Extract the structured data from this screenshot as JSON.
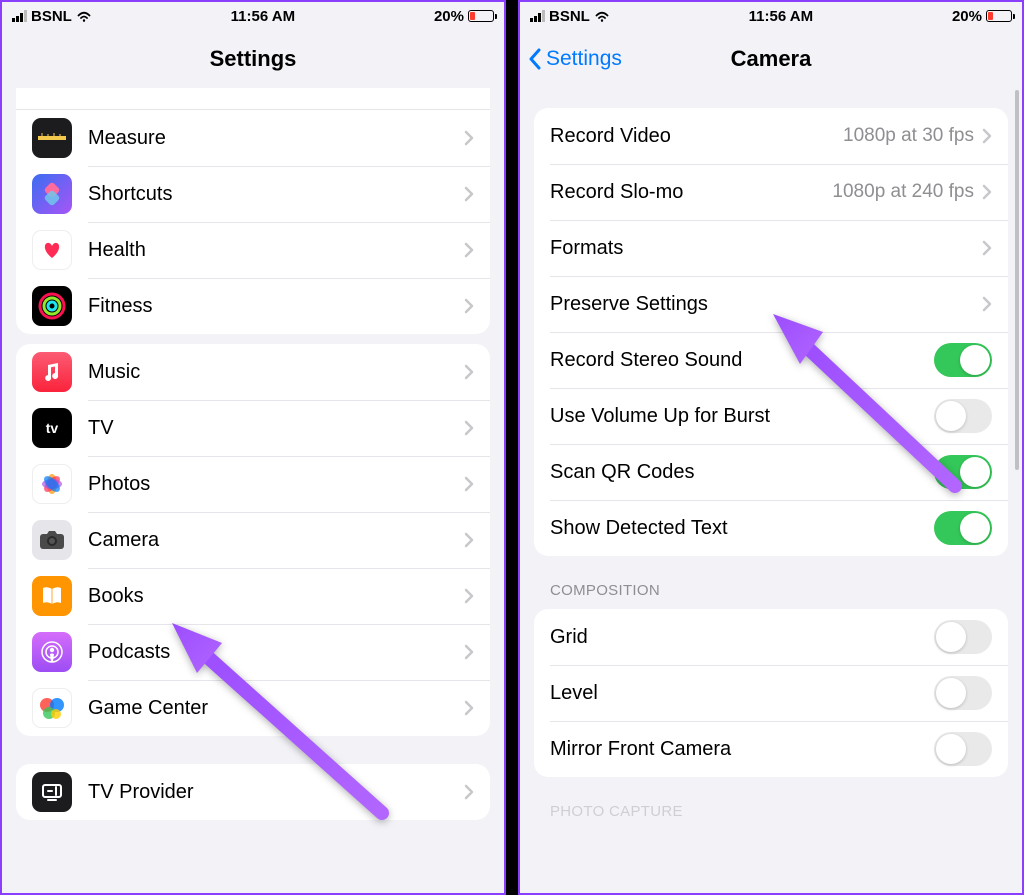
{
  "status": {
    "carrier": "BSNL",
    "time": "11:56 AM",
    "battery_pct": "20%"
  },
  "left": {
    "title": "Settings",
    "groups": [
      {
        "rows": [
          {
            "icon": "measure",
            "label": "Measure"
          },
          {
            "icon": "shortcuts",
            "label": "Shortcuts"
          },
          {
            "icon": "health",
            "label": "Health"
          },
          {
            "icon": "fitness",
            "label": "Fitness"
          }
        ]
      },
      {
        "rows": [
          {
            "icon": "music",
            "label": "Music"
          },
          {
            "icon": "tv",
            "label": "TV"
          },
          {
            "icon": "photos",
            "label": "Photos"
          },
          {
            "icon": "camera",
            "label": "Camera"
          },
          {
            "icon": "books",
            "label": "Books"
          },
          {
            "icon": "podcasts",
            "label": "Podcasts"
          },
          {
            "icon": "gamecenter",
            "label": "Game Center"
          }
        ]
      },
      {
        "rows": [
          {
            "icon": "tvprovider",
            "label": "TV Provider"
          }
        ]
      }
    ]
  },
  "right": {
    "back": "Settings",
    "title": "Camera",
    "groups": [
      {
        "rows": [
          {
            "label": "Record Video",
            "detail": "1080p at 30 fps",
            "type": "nav"
          },
          {
            "label": "Record Slo-mo",
            "detail": "1080p at 240 fps",
            "type": "nav"
          },
          {
            "label": "Formats",
            "type": "nav"
          },
          {
            "label": "Preserve Settings",
            "type": "nav"
          },
          {
            "label": "Record Stereo Sound",
            "type": "switch",
            "on": true
          },
          {
            "label": "Use Volume Up for Burst",
            "type": "switch",
            "on": false
          },
          {
            "label": "Scan QR Codes",
            "type": "switch",
            "on": true
          },
          {
            "label": "Show Detected Text",
            "type": "switch",
            "on": true
          }
        ]
      },
      {
        "header": "COMPOSITION",
        "rows": [
          {
            "label": "Grid",
            "type": "switch",
            "on": false
          },
          {
            "label": "Level",
            "type": "switch",
            "on": false
          },
          {
            "label": "Mirror Front Camera",
            "type": "switch",
            "on": false
          }
        ]
      },
      {
        "header": "PHOTO CAPTURE",
        "rows": []
      }
    ]
  }
}
